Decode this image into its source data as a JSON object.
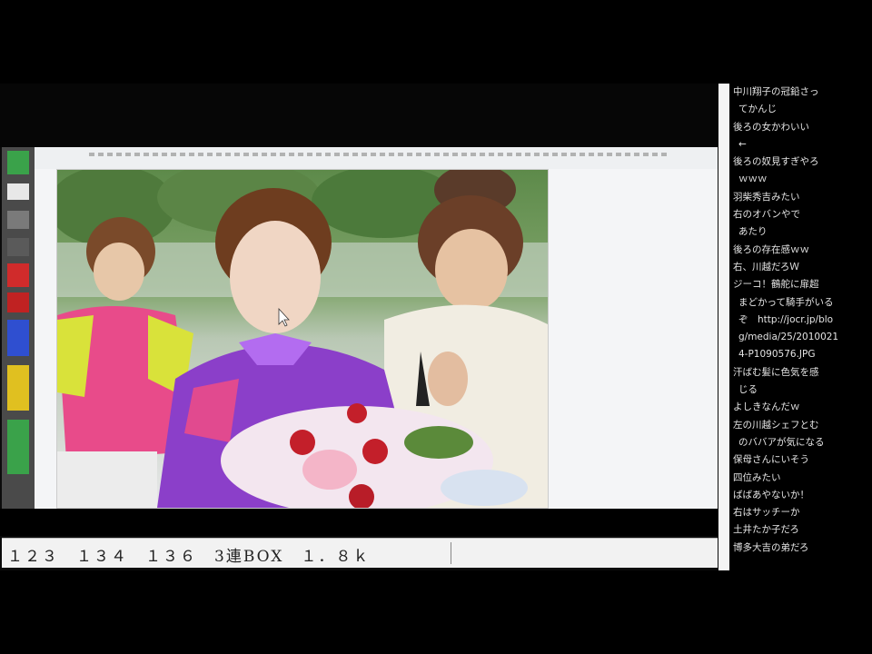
{
  "ticker": {
    "text": "１２３　１３４　１３６　3連BOX　１．８ｋ"
  },
  "comments": [
    {
      "text": "中川翔子の冠鉛さっ",
      "marker": true
    },
    {
      "text": "てかんじ",
      "marker": false
    },
    {
      "text": "後ろの女かわいい",
      "marker": true
    },
    {
      "text": "←",
      "marker": false
    },
    {
      "text": "後ろの奴見すぎやろ",
      "marker": true
    },
    {
      "text": "ｗｗｗ",
      "marker": false
    },
    {
      "text": "羽柴秀吉みたい",
      "marker": true
    },
    {
      "text": "右のオバンやで",
      "marker": true
    },
    {
      "text": "あたり",
      "marker": false
    },
    {
      "text": "後ろの存在感ｗｗ",
      "marker": true
    },
    {
      "text": "右、川越だろＷ",
      "marker": true
    },
    {
      "text": "ジーコ！鶴舵に扉超",
      "marker": true
    },
    {
      "text": "まどかって騎手がいる",
      "marker": false
    },
    {
      "text": "ぞ　http://jocr.jp/blo",
      "marker": false
    },
    {
      "text": "g/media/25/2010021",
      "marker": false
    },
    {
      "text": "4-P1090576.JPG",
      "marker": false
    },
    {
      "text": "汗ばむ髪に色気を感",
      "marker": true
    },
    {
      "text": "じる",
      "marker": false
    },
    {
      "text": "よしきなんだｗ",
      "marker": true
    },
    {
      "text": "左の川越シェフとむ",
      "marker": true
    },
    {
      "text": "のババアが気になる",
      "marker": false
    },
    {
      "text": "保母さんにいそう",
      "marker": true
    },
    {
      "text": "四位みたい",
      "marker": true
    },
    {
      "text": "ばばあやないか！",
      "marker": true
    },
    {
      "text": "右はサッチーか",
      "marker": true
    },
    {
      "text": "土井たか子だろ",
      "marker": true
    },
    {
      "text": "博多大吉の弟だろ",
      "marker": true
    }
  ],
  "colors": {
    "strip_blocks": [
      "#3aa24a",
      "#e8e8e8",
      "#888888",
      "#5a5a5a",
      "#d02b2b",
      "#c02222",
      "#2f4fd0",
      "#e0c020",
      "#3aa24a",
      "#3aa24a"
    ]
  }
}
